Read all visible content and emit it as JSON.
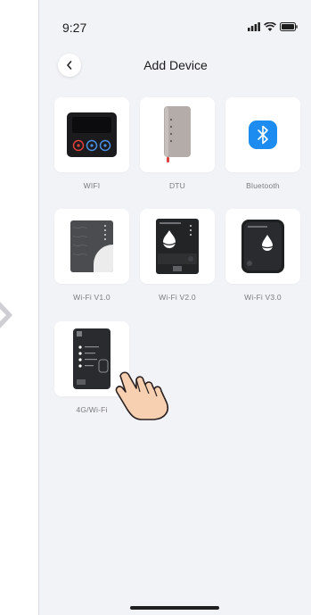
{
  "status_bar": {
    "time": "9:27",
    "icons": [
      "signal-icon",
      "wifi-icon",
      "battery-icon"
    ]
  },
  "header": {
    "title": "Add Device",
    "back_icon": "chevron-left-icon"
  },
  "devices": [
    {
      "label": "WIFI",
      "icon": "wifi-device-icon"
    },
    {
      "label": "DTU",
      "icon": "dtu-device-icon"
    },
    {
      "label": "Bluetooth",
      "icon": "bluetooth-icon"
    },
    {
      "label": "Wi-Fi V1.0",
      "icon": "wifi-v1-device-icon"
    },
    {
      "label": "Wi-Fi V2.0",
      "icon": "wifi-v2-device-icon"
    },
    {
      "label": "Wi-Fi V3.0",
      "icon": "wifi-v3-device-icon"
    },
    {
      "label": "4G/Wi-Fi",
      "icon": "4g-wifi-device-icon"
    }
  ],
  "colors": {
    "background": "#f2f3f7",
    "card": "#ffffff",
    "bluetooth": "#1d8cf0",
    "accent_red": "#e1403c",
    "hand_fill": "#f6d0b0"
  }
}
